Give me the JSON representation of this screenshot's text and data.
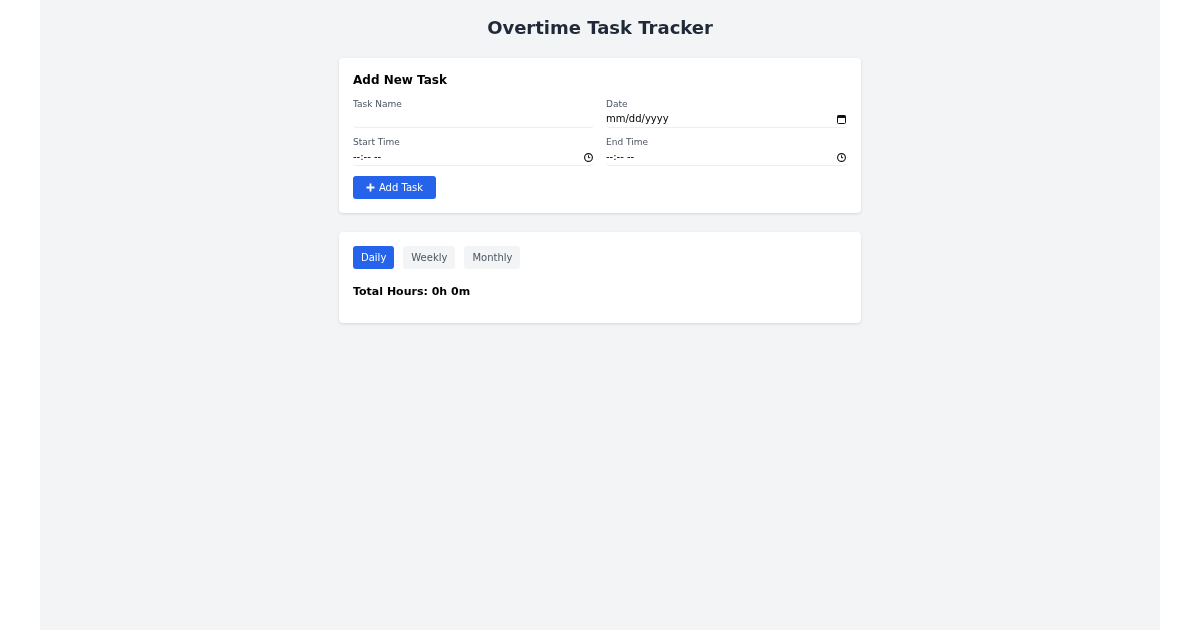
{
  "title": "Overtime Task Tracker",
  "add_task": {
    "heading": "Add New Task",
    "fields": [
      {
        "label": "Task Name",
        "kind": "text"
      },
      {
        "label": "Date",
        "kind": "date",
        "placeholder": "mm/dd/yyyy"
      },
      {
        "label": "Start Time",
        "kind": "time",
        "placeholder": "--:-- --"
      },
      {
        "label": "End Time",
        "kind": "time",
        "placeholder": "--:-- --"
      }
    ],
    "button": "Add Task"
  },
  "summary": {
    "tabs": [
      {
        "label": "Daily",
        "selected": true
      },
      {
        "label": "Weekly",
        "selected": false
      },
      {
        "label": "Monthly",
        "selected": false
      }
    ],
    "total": "Total Hours: 0h 0m"
  }
}
